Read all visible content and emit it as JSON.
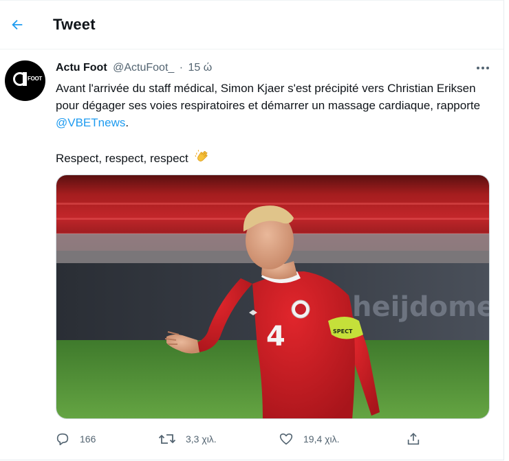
{
  "header": {
    "title": "Tweet",
    "back_icon": "arrow-left-icon",
    "accent": "#1d9bf0"
  },
  "author": {
    "avatar_text": "FOOT",
    "name": "Actu Foot",
    "handle": "@ActuFoot_",
    "separator": "·",
    "time": "15 ώ"
  },
  "tweet": {
    "text_before_mention": "Avant l'arrivée du staff médical, Simon Kjaer s'est précipité vers Christian Eriksen pour dégager ses voies respiratoires et démarrer un massage cardiaque, rapporte ",
    "mention": "@VBETnews",
    "text_after_mention": ".",
    "second_line": "Respect, respect, respect",
    "emoji": "clapping-hands-icon"
  },
  "media": {
    "jersey_number": "4",
    "armband_text": "SPECT",
    "board_text": "heijdomes"
  },
  "actions": {
    "reply_count": "166",
    "retweet_count": "3,3 χιλ.",
    "like_count": "19,4 χιλ."
  }
}
